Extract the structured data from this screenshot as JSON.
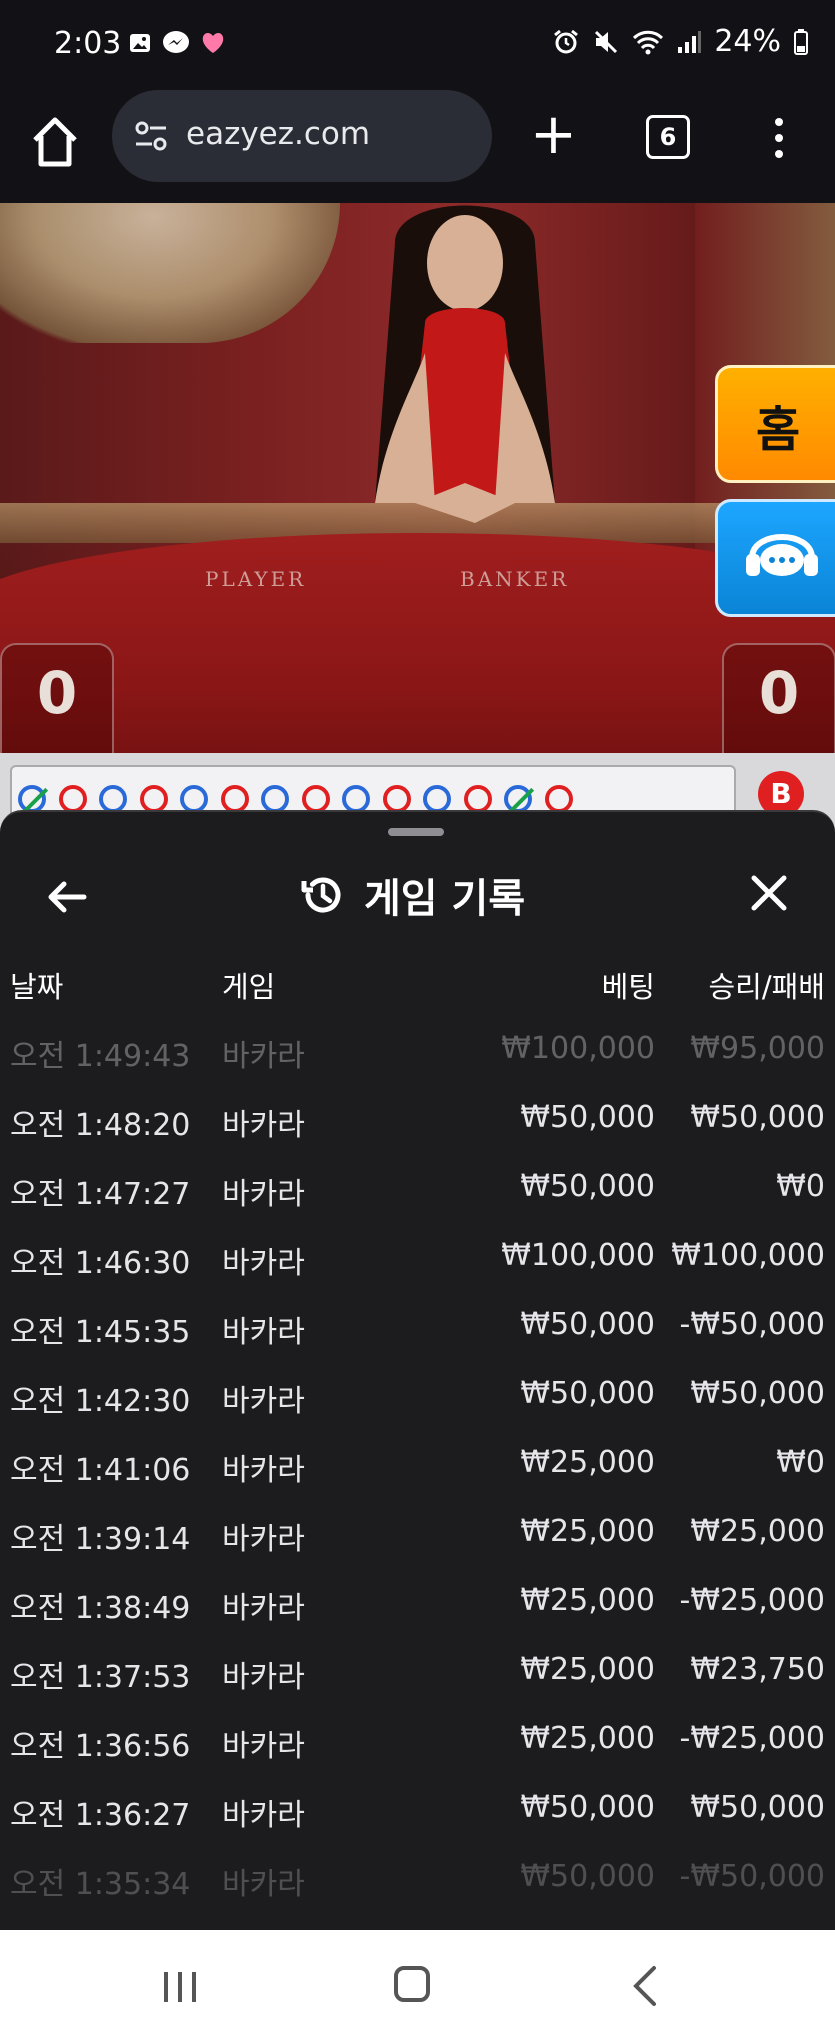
{
  "status_bar": {
    "time": "2:03",
    "battery": "24%",
    "left_icons": [
      "gallery-icon",
      "messenger-icon",
      "heart-icon"
    ],
    "right_icons": [
      "alarm-icon",
      "mute-icon",
      "wifi-icon",
      "signal-icon",
      "battery-icon"
    ]
  },
  "browser": {
    "url": "eazyez.com",
    "tab_count": "6"
  },
  "video": {
    "felt_left": "PLAYER",
    "felt_right": "BANKER",
    "player_score": "0",
    "banker_score": "0"
  },
  "side_buttons": {
    "home_label": "홈"
  },
  "bead_road": {
    "badge": "B",
    "beads": [
      {
        "color": "blue",
        "tie": true
      },
      {
        "color": "red",
        "tie": false
      },
      {
        "color": "blue",
        "tie": false
      },
      {
        "color": "red",
        "tie": false
      },
      {
        "color": "blue",
        "tie": false
      },
      {
        "color": "red",
        "tie": false
      },
      {
        "color": "blue",
        "tie": false
      },
      {
        "color": "red",
        "tie": false
      },
      {
        "color": "blue",
        "tie": false
      },
      {
        "color": "red",
        "tie": false
      },
      {
        "color": "blue",
        "tie": false
      },
      {
        "color": "red",
        "tie": false
      },
      {
        "color": "blue",
        "tie": true
      },
      {
        "color": "red",
        "tie": false
      }
    ]
  },
  "history": {
    "title": "게임 기록",
    "columns": {
      "date": "날짜",
      "game": "게임",
      "bet": "베팅",
      "win_loss": "승리/패배"
    },
    "rows": [
      {
        "time": "오전 1:49:43",
        "game": "바카라",
        "bet": "₩100,000",
        "result": "₩95,000"
      },
      {
        "time": "오전 1:48:20",
        "game": "바카라",
        "bet": "₩50,000",
        "result": "₩50,000"
      },
      {
        "time": "오전 1:47:27",
        "game": "바카라",
        "bet": "₩50,000",
        "result": "₩0"
      },
      {
        "time": "오전 1:46:30",
        "game": "바카라",
        "bet": "₩100,000",
        "result": "₩100,000"
      },
      {
        "time": "오전 1:45:35",
        "game": "바카라",
        "bet": "₩50,000",
        "result": "-₩50,000"
      },
      {
        "time": "오전 1:42:30",
        "game": "바카라",
        "bet": "₩50,000",
        "result": "₩50,000"
      },
      {
        "time": "오전 1:41:06",
        "game": "바카라",
        "bet": "₩25,000",
        "result": "₩0"
      },
      {
        "time": "오전 1:39:14",
        "game": "바카라",
        "bet": "₩25,000",
        "result": "₩25,000"
      },
      {
        "time": "오전 1:38:49",
        "game": "바카라",
        "bet": "₩25,000",
        "result": "-₩25,000"
      },
      {
        "time": "오전 1:37:53",
        "game": "바카라",
        "bet": "₩25,000",
        "result": "₩23,750"
      },
      {
        "time": "오전 1:36:56",
        "game": "바카라",
        "bet": "₩25,000",
        "result": "-₩25,000"
      },
      {
        "time": "오전 1:36:27",
        "game": "바카라",
        "bet": "₩50,000",
        "result": "₩50,000"
      },
      {
        "time": "오전 1:35:34",
        "game": "바카라",
        "bet": "₩50,000",
        "result": "-₩50,000"
      }
    ]
  }
}
